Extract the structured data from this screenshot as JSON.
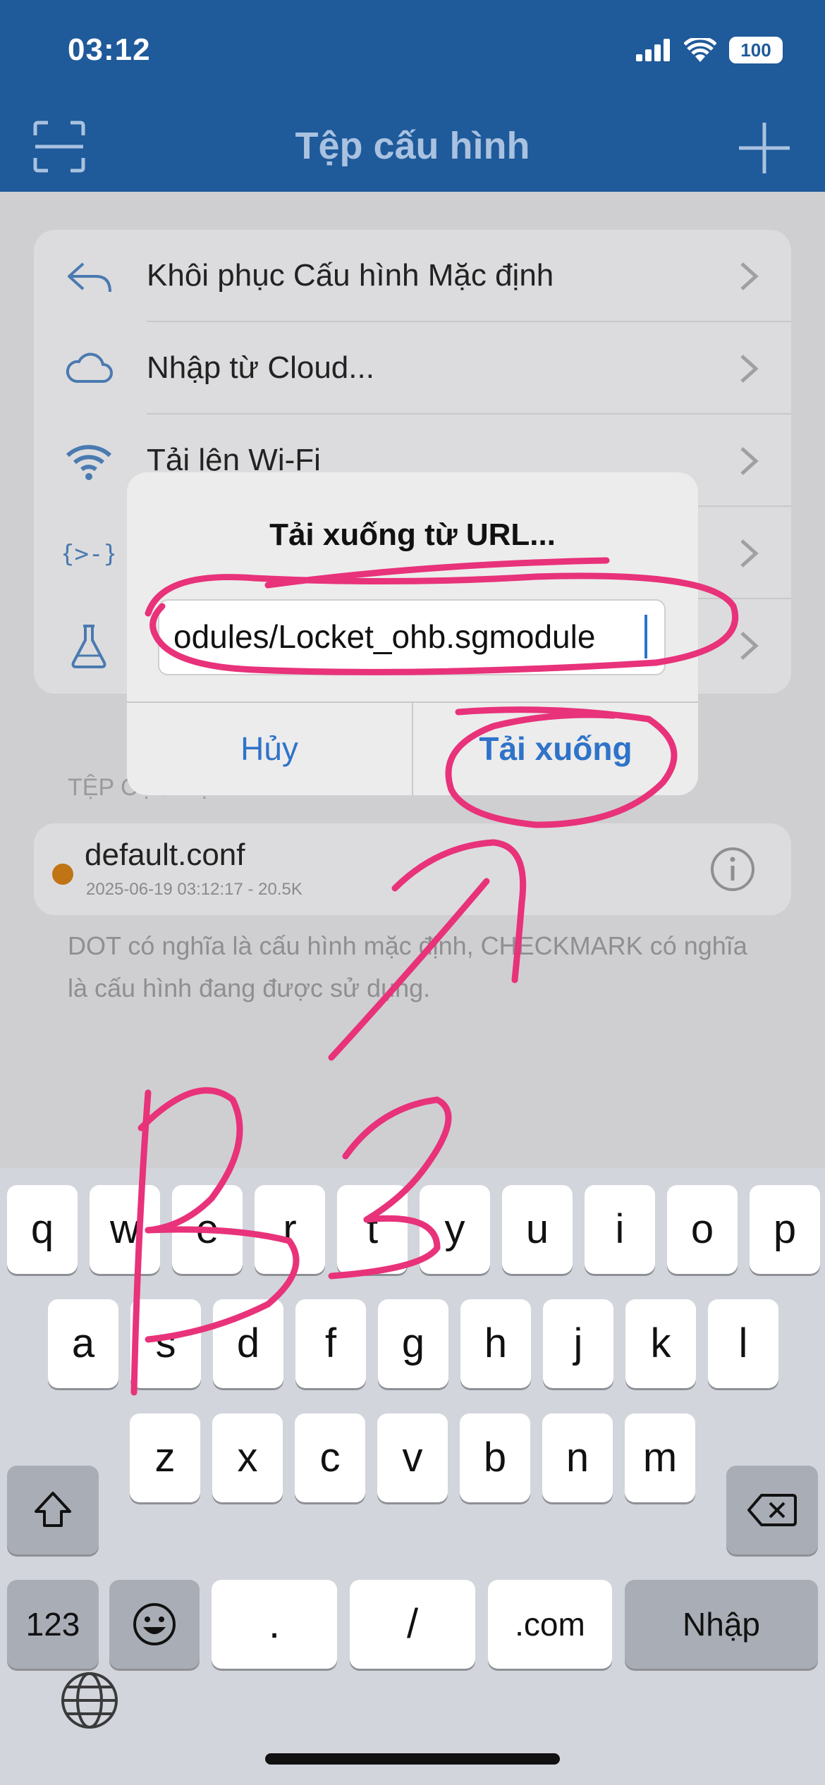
{
  "status_bar": {
    "time": "03:12",
    "battery": "100"
  },
  "nav": {
    "title": "Tệp cấu hình",
    "left_icon": "scan-icon",
    "right_icon": "plus-icon"
  },
  "menu": [
    {
      "label": "Khôi phục Cấu hình Mặc định",
      "icon": "restore-icon"
    },
    {
      "label": "Nhập từ Cloud...",
      "icon": "cloud-icon"
    },
    {
      "label": "Tải lên Wi-Fi",
      "icon": "wifi-icon"
    },
    {
      "label": "",
      "icon": "script-icon"
    },
    {
      "label": "",
      "icon": "flask-icon"
    }
  ],
  "section": {
    "label": "TỆP CỤC BỘ"
  },
  "file": {
    "name": "default.conf",
    "meta": "2025-06-19 03:12:17 - 20.5K"
  },
  "note": "DOT có nghĩa là cấu hình mặc định, CHECKMARK có nghĩa là cấu hình đang được sử dụng.",
  "dialog": {
    "title": "Tải xuống từ URL...",
    "url_value": "odules/Locket_ohb.sgmodule",
    "cancel_label": "Hủy",
    "confirm_label": "Tải xuống"
  },
  "keyboard": {
    "row1": [
      "q",
      "w",
      "e",
      "r",
      "t",
      "y",
      "u",
      "i",
      "o",
      "p"
    ],
    "row2": [
      "a",
      "s",
      "d",
      "f",
      "g",
      "h",
      "j",
      "k",
      "l"
    ],
    "row3": [
      "z",
      "x",
      "c",
      "v",
      "b",
      "n",
      "m"
    ],
    "numbers_key": "123",
    "dot_key": ".",
    "slash_key": "/",
    "com_key": ".com",
    "return_key": "Nhập"
  },
  "annotation": {
    "handwritten_text": "B3",
    "color": "#e8327a"
  },
  "colors": {
    "nav_bg": "#1f5a9a",
    "accent": "#2f73c9",
    "default_dot": "#c07413"
  }
}
